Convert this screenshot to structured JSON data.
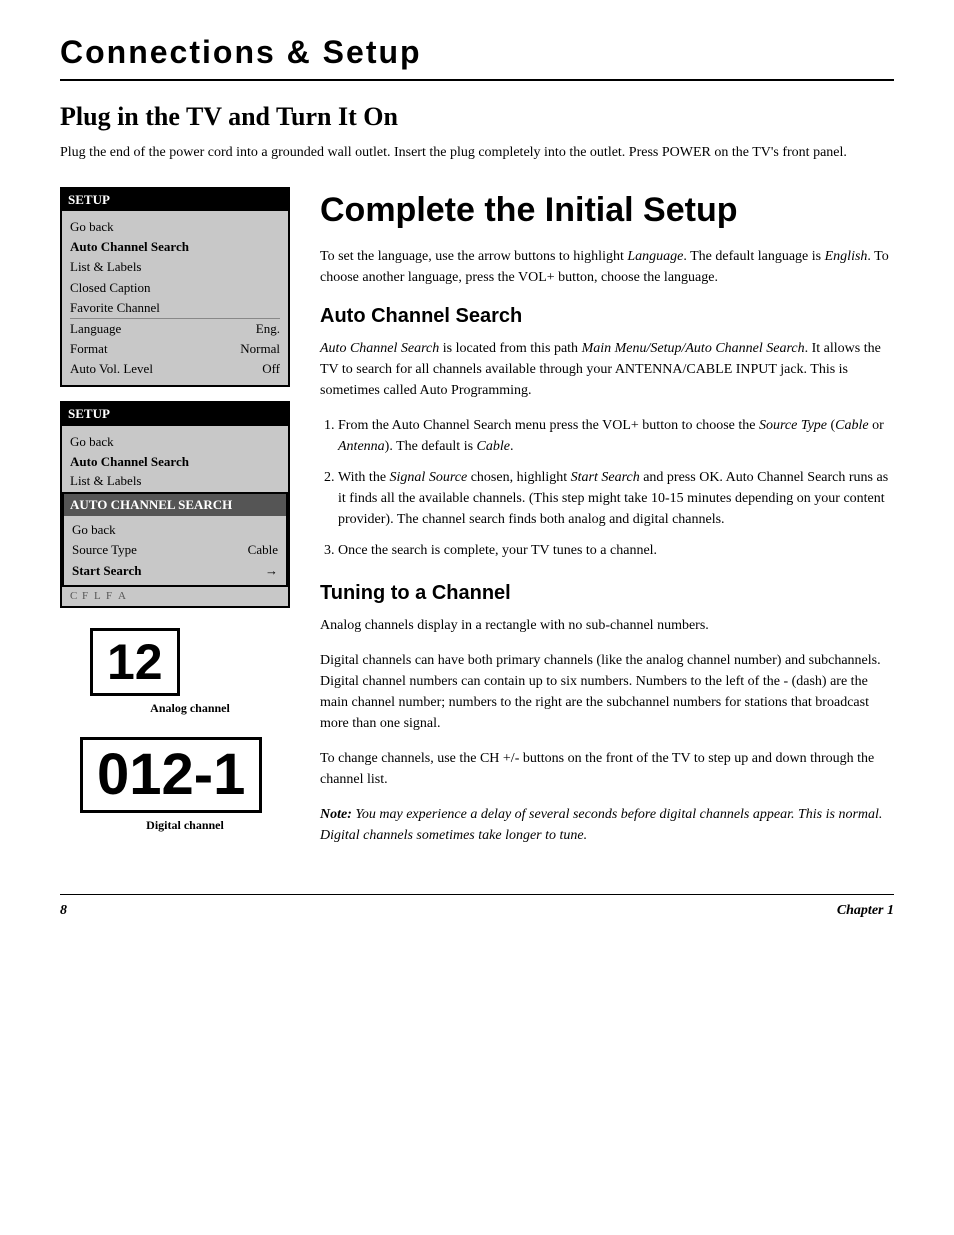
{
  "page": {
    "header_title": "Connections & Setup",
    "footer_page": "8",
    "footer_chapter": "Chapter 1"
  },
  "plug_section": {
    "title": "Plug in the TV and Turn It On",
    "body": "Plug the end of the power cord into a grounded wall outlet. Insert the plug completely into the outlet. Press POWER on the TV's front panel."
  },
  "setup_menu_1": {
    "title": "SETUP",
    "items": [
      {
        "label": "Go back",
        "value": "",
        "bold": false
      },
      {
        "label": "Auto Channel Search",
        "value": "",
        "bold": true
      },
      {
        "label": "List & Labels",
        "value": "",
        "bold": false
      },
      {
        "label": "Closed Caption",
        "value": "",
        "bold": false
      },
      {
        "label": "Favorite Channel",
        "value": "",
        "bold": false
      },
      {
        "label": "Language",
        "value": "Eng.",
        "bold": false,
        "separator": true
      },
      {
        "label": "Format",
        "value": "Normal",
        "bold": false
      },
      {
        "label": "Auto Vol. Level",
        "value": "Off",
        "bold": false
      }
    ]
  },
  "setup_menu_2": {
    "title": "SETUP",
    "items": [
      {
        "label": "Go back",
        "value": "",
        "bold": false
      },
      {
        "label": "Auto Channel Search",
        "value": "",
        "bold": true
      }
    ],
    "clipped_items": [
      {
        "label": "List & Labels",
        "clipped": true
      },
      {
        "label": "C",
        "clipped": true
      },
      {
        "label": "F",
        "clipped": true
      },
      {
        "label": "L",
        "clipped": true
      },
      {
        "label": "F",
        "clipped": true
      },
      {
        "label": "A",
        "clipped": true
      }
    ]
  },
  "submenu": {
    "title": "AUTO CHANNEL SEARCH",
    "items": [
      {
        "label": "Go back",
        "value": "",
        "bold": false
      },
      {
        "label": "Source Type",
        "value": "Cable",
        "bold": false
      },
      {
        "label": "Start Search",
        "value": "→",
        "bold": true
      }
    ]
  },
  "analog_channel": {
    "number": "12",
    "label": "Analog channel"
  },
  "digital_channel": {
    "number": "012-1",
    "label": "Digital channel"
  },
  "complete_setup": {
    "title": "Complete the Initial Setup",
    "intro": "To set the language, use the arrow buttons to highlight Language. The default language is English. To choose another language, press the VOL+ button, choose the language.",
    "intro_italic_1": "Language",
    "intro_italic_2": "English"
  },
  "auto_channel_search": {
    "title": "Auto Channel Search",
    "intro": "Auto Channel Search is located from this path Main Menu/Setup/Auto Channel Search. It allows the TV to search for all channels available through your ANTENNA/CABLE INPUT jack. This is sometimes called Auto Programming.",
    "intro_italic": "Auto Channel Search",
    "intro_italic_2": "Main Menu/Setup/Auto Channel Search",
    "steps": [
      {
        "num": 1,
        "text": "From the Auto Channel Search menu press the VOL+ button to choose the Source Type (Cable or Antenna). The default is Cable.",
        "italics": [
          "Source Type",
          "Cable",
          "Antenna",
          "Cable"
        ]
      },
      {
        "num": 2,
        "text": "With the Signal Source chosen, highlight Start Search and press OK. Auto Channel Search runs as it finds all the available channels. (This step might take 10-15 minutes depending on your content provider). The channel search finds both analog and digital channels.",
        "italics": [
          "Signal Source",
          "Start Search"
        ]
      },
      {
        "num": 3,
        "text": "Once the search is complete, your TV tunes to a channel."
      }
    ]
  },
  "tuning": {
    "title": "Tuning to a Channel",
    "para1": "Analog channels display in a rectangle with no sub-channel numbers.",
    "para2": "Digital channels can have both primary channels (like the analog channel number) and subchannels. Digital channel numbers can contain up to six numbers. Numbers to the left of the - (dash) are the main channel number; numbers to the right are the subchannel numbers for stations that broadcast more than one signal.",
    "para3": "To change channels, use the CH +/- buttons on the front of the TV to step up and down through the channel list.",
    "note": "Note: You may experience a delay of several seconds before digital channels appear. This is normal. Digital channels sometimes take longer to tune."
  }
}
